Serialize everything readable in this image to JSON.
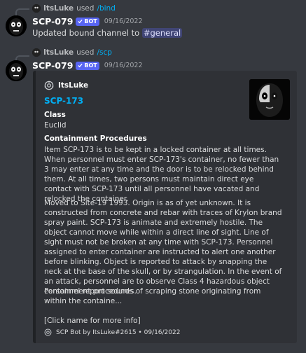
{
  "messages": [
    {
      "reply": {
        "user": "ItsLuke",
        "used": "used",
        "command": "/bind"
      },
      "author": {
        "name": "SCP-079",
        "tag": "BOT",
        "timestamp": "09/16/2022"
      },
      "content": {
        "text": "Updated bound channel to",
        "mention": "#general"
      }
    },
    {
      "reply": {
        "user": "ItsLuke",
        "used": "used",
        "command": "/scp"
      },
      "author": {
        "name": "SCP-079",
        "tag": "BOT",
        "timestamp": "09/16/2022"
      }
    }
  ],
  "embed": {
    "author": "ItsLuke",
    "title": "SCP-173",
    "class_label": "Class",
    "class_value": "Euclid",
    "containment_label": "Containment Procedures",
    "paragraph1": "Item SCP-173 is to be kept in a locked container at all times. When personnel must enter SCP-173's container, no fewer than 3 may enter at any time and the door is to be relocked behind them. At all times, two persons must maintain direct eye contact with SCP-173 until all personnel have vacated and relocked the container.",
    "paragraph2": "Moved to Site-19 1993. Origin is as of yet unknown. It is constructed from concrete and rebar with traces of Krylon brand spray paint. SCP-173 is animate and extremely hostile. The object cannot move while within a direct line of sight. Line of sight must not be broken at any time with SCP-173. Personnel assigned to enter container are instructed to alert one another before blinking. Object is reported to attack by snapping the neck at the base of the skull, or by strangulation. In the event of an attack, personnel are to observe Class 4 hazardous object containment procedures.",
    "paragraph3": "Personnel report sounds of scraping stone originating from within the containe...",
    "click_hint": "[Click name for more info]",
    "footer": "SCP Bot by ItsLuke#2615 • 09/16/2022"
  },
  "colors": {
    "background": "#36393f",
    "embed_bg": "#2f3136",
    "link": "#00aff4",
    "bot_tag": "#5865f2"
  },
  "icons": {
    "embed_author_icon": "scp-logo-icon",
    "footer_icon": "scp-logo-icon",
    "verified": "check-icon"
  }
}
